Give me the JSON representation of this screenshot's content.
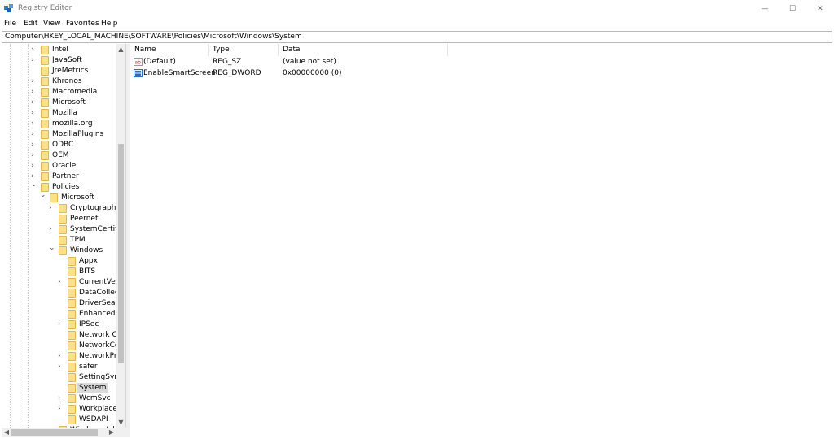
{
  "window": {
    "title": "Registry Editor",
    "minimize_glyph": "—",
    "maximize_glyph": "☐",
    "close_glyph": "✕"
  },
  "menu": [
    "File",
    "Edit",
    "View",
    "Favorites",
    "Help"
  ],
  "address": "Computer\\HKEY_LOCAL_MACHINE\\SOFTWARE\\Policies\\Microsoft\\Windows\\System",
  "tree": [
    {
      "label": "Intel",
      "level": 0,
      "expander": "closed"
    },
    {
      "label": "JavaSoft",
      "level": 0,
      "expander": "closed"
    },
    {
      "label": "JreMetrics",
      "level": 0,
      "expander": "none"
    },
    {
      "label": "Khronos",
      "level": 0,
      "expander": "closed"
    },
    {
      "label": "Macromedia",
      "level": 0,
      "expander": "closed"
    },
    {
      "label": "Microsoft",
      "level": 0,
      "expander": "closed"
    },
    {
      "label": "Mozilla",
      "level": 0,
      "expander": "closed"
    },
    {
      "label": "mozilla.org",
      "level": 0,
      "expander": "closed"
    },
    {
      "label": "MozillaPlugins",
      "level": 0,
      "expander": "closed"
    },
    {
      "label": "ODBC",
      "level": 0,
      "expander": "closed"
    },
    {
      "label": "OEM",
      "level": 0,
      "expander": "closed"
    },
    {
      "label": "Oracle",
      "level": 0,
      "expander": "closed"
    },
    {
      "label": "Partner",
      "level": 0,
      "expander": "closed"
    },
    {
      "label": "Policies",
      "level": 0,
      "expander": "open"
    },
    {
      "label": "Microsoft",
      "level": 1,
      "expander": "open"
    },
    {
      "label": "Cryptography",
      "level": 2,
      "expander": "closed"
    },
    {
      "label": "Peernet",
      "level": 2,
      "expander": "none"
    },
    {
      "label": "SystemCertific",
      "level": 2,
      "expander": "closed"
    },
    {
      "label": "TPM",
      "level": 2,
      "expander": "none"
    },
    {
      "label": "Windows",
      "level": 2,
      "expander": "open"
    },
    {
      "label": "Appx",
      "level": 3,
      "expander": "none"
    },
    {
      "label": "BITS",
      "level": 3,
      "expander": "none"
    },
    {
      "label": "CurrentVers",
      "level": 3,
      "expander": "closed"
    },
    {
      "label": "DataCollect",
      "level": 3,
      "expander": "none"
    },
    {
      "label": "DriverSearc",
      "level": 3,
      "expander": "none"
    },
    {
      "label": "EnhancedS",
      "level": 3,
      "expander": "none"
    },
    {
      "label": "IPSec",
      "level": 3,
      "expander": "closed"
    },
    {
      "label": "Network Co",
      "level": 3,
      "expander": "none"
    },
    {
      "label": "NetworkCo",
      "level": 3,
      "expander": "none"
    },
    {
      "label": "NetworkPro",
      "level": 3,
      "expander": "closed"
    },
    {
      "label": "safer",
      "level": 3,
      "expander": "closed"
    },
    {
      "label": "SettingSync",
      "level": 3,
      "expander": "none"
    },
    {
      "label": "System",
      "level": 3,
      "expander": "none",
      "selected": true
    },
    {
      "label": "WcmSvc",
      "level": 3,
      "expander": "closed"
    },
    {
      "label": "WorkplaceJ",
      "level": 3,
      "expander": "closed"
    },
    {
      "label": "WSDAPI",
      "level": 3,
      "expander": "none"
    },
    {
      "label": "Windows Adv",
      "level": 2,
      "expander": "closed"
    }
  ],
  "columns": {
    "name": "Name",
    "type": "Type",
    "data": "Data"
  },
  "values": [
    {
      "name": "(Default)",
      "type": "REG_SZ",
      "data": "(value not set)",
      "icon": "string-value-icon"
    },
    {
      "name": "EnableSmartScreen",
      "type": "REG_DWORD",
      "data": "0x00000000 (0)",
      "icon": "dword-value-icon"
    }
  ],
  "colors": {
    "folder": "#ffe08a",
    "folder_border": "#e3b84b",
    "selection": "#d9d9d9",
    "scrollbar_track": "#f0f0f0",
    "scrollbar_thumb": "#c2c2c2"
  }
}
